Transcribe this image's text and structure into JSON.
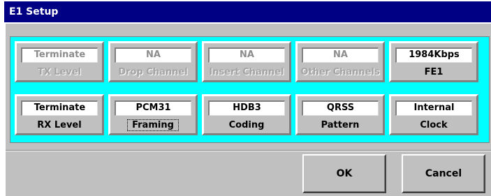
{
  "window": {
    "title": "E1 Setup"
  },
  "colors": {
    "titlebar": "#000084",
    "panel": "#00ffff",
    "face": "#c0c0c0",
    "disabled_text": "#a4a4a4"
  },
  "rows": [
    [
      {
        "value": "Terminate",
        "label": "TX Level",
        "enabled": false
      },
      {
        "value": "NA",
        "label": "Drop Channel",
        "enabled": false
      },
      {
        "value": "NA",
        "label": "Insert Channel",
        "enabled": false
      },
      {
        "value": "NA",
        "label": "Other Channels",
        "enabled": false
      },
      {
        "value": "1984Kbps",
        "label": "FE1",
        "enabled": true
      }
    ],
    [
      {
        "value": "Terminate",
        "label": "RX Level",
        "enabled": true
      },
      {
        "value": "PCM31",
        "label": "Framing",
        "enabled": true,
        "focused": true
      },
      {
        "value": "HDB3",
        "label": "Coding",
        "enabled": true
      },
      {
        "value": "QRSS",
        "label": "Pattern",
        "enabled": true
      },
      {
        "value": "Internal",
        "label": "Clock",
        "enabled": true
      }
    ]
  ],
  "buttons": {
    "ok": "OK",
    "cancel": "Cancel"
  }
}
